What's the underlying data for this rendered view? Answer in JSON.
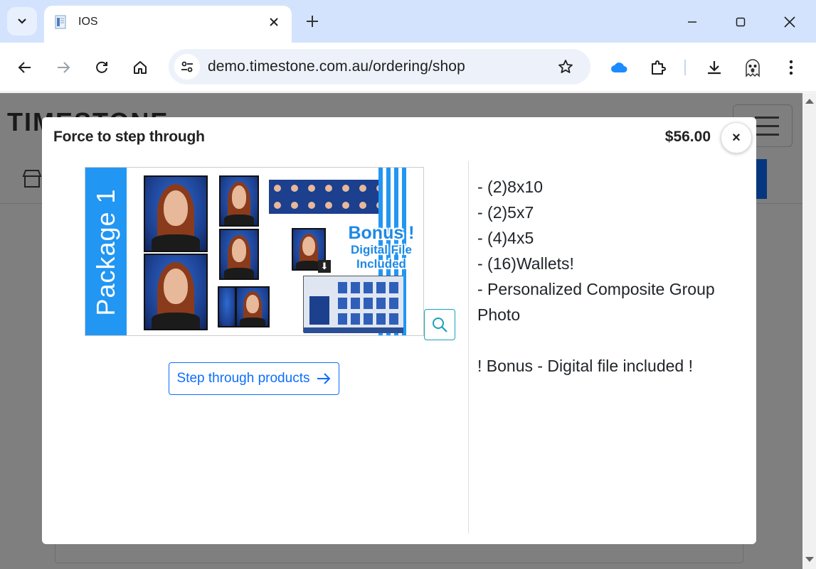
{
  "browser": {
    "tab_title": "IOS",
    "url": "demo.timestone.com.au/ordering/shop"
  },
  "page": {
    "logo_text": "TIMESTONE"
  },
  "modal": {
    "title": "Force to step through",
    "price": "$56.00",
    "close_label": "×",
    "image": {
      "band_label": "Package 1",
      "bonus_line1": "Bonus !",
      "bonus_line2": "Digital File",
      "bonus_line3": "Included"
    },
    "step_button_label": "Step through products",
    "description": [
      "- (2)8x10",
      "- (2)5x7",
      "- (4)4x5",
      "- (16)Wallets!",
      "- Personalized Composite Group Photo",
      "",
      "! Bonus - Digital file included !"
    ]
  },
  "colors": {
    "accent": "#0d6efd",
    "package_band": "#2196f3",
    "zoom_border": "#17a2b8"
  }
}
